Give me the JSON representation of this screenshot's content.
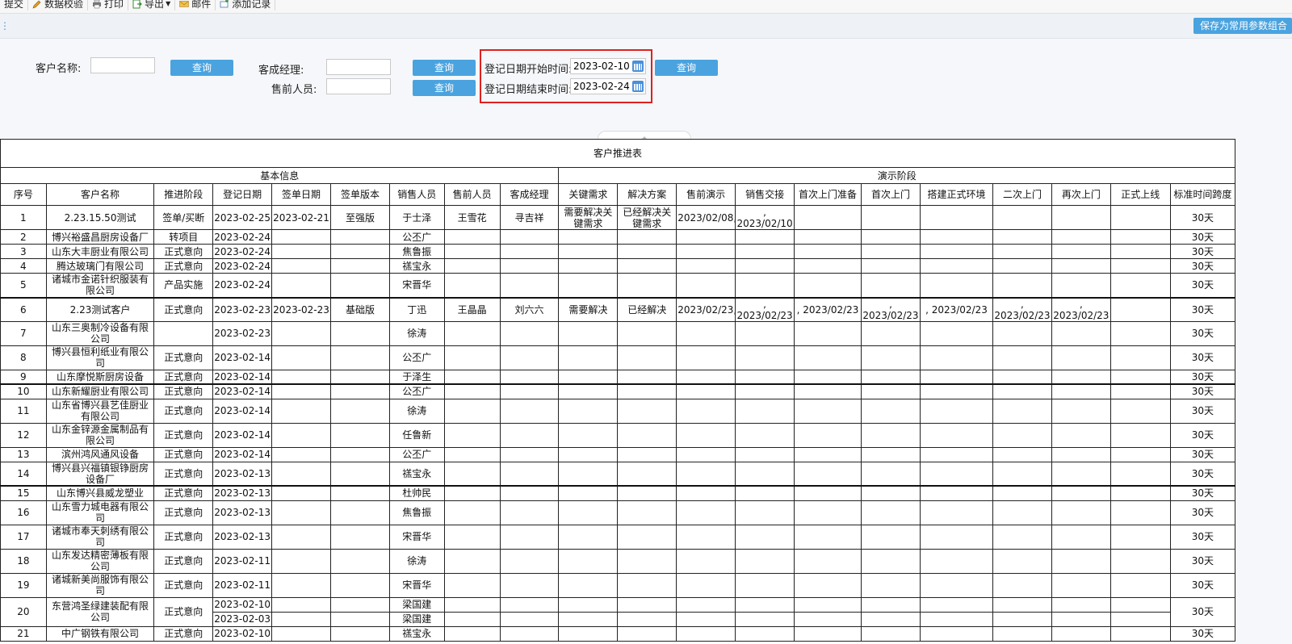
{
  "toolbar": {
    "items": [
      {
        "label": "提交",
        "icon": "submit-icon"
      },
      {
        "label": "数据校验",
        "icon": "pencil-icon"
      },
      {
        "label": "打印",
        "icon": "printer-icon"
      },
      {
        "label": "导出",
        "icon": "export-icon"
      },
      {
        "label": "邮件",
        "icon": "mail-icon"
      },
      {
        "label": "添加记录",
        "icon": "add-record-icon"
      }
    ],
    "save_params": "保存为常用参数组合"
  },
  "filters": {
    "customer_name_label": "客户名称:",
    "customer_name_value": "",
    "success_manager_label": "客成经理:",
    "success_manager_value": "",
    "presales_label": "售前人员:",
    "presales_value": "",
    "start_date_label": "登记日期开始时间:",
    "start_date_value": "2023-02-10",
    "end_date_label": "登记日期结束时间:",
    "end_date_value": "2023-02-24",
    "query_label": "查询"
  },
  "table": {
    "title": "客户推进表",
    "group_basic": "基本信息",
    "group_demo": "演示阶段",
    "headers": [
      "序号",
      "客户名称",
      "推进阶段",
      "登记日期",
      "签单日期",
      "签单版本",
      "销售人员",
      "售前人员",
      "客成经理",
      "关键需求",
      "解决方案",
      "售前演示",
      "销售交接",
      "首次上门准备",
      "首次上门",
      "搭建正式环境",
      "二次上门",
      "再次上门",
      "正式上线",
      "标准时间跨度"
    ],
    "rows": [
      {
        "no": "1",
        "name": "2.23.15.50测试",
        "stage": "签单/买断",
        "reg": "2023-02-25",
        "sign": "2023-02-21",
        "ver": "至强版",
        "sales": "于士泽",
        "pre": "王雪花",
        "mgr": "寻吉祥",
        "need": "需要解决关键需求",
        "sol": "已经解决关键需求",
        "demo": "2023/02/08,",
        "handover": ", 2023/02/10",
        "prep": "",
        "first": "",
        "env": "",
        "second": "",
        "again": "",
        "online": "",
        "span": "30天"
      },
      {
        "no": "2",
        "name": "博兴裕盛昌厨房设备厂",
        "stage": "转项目",
        "reg": "2023-02-24",
        "sign": "",
        "ver": "",
        "sales": "公丕广",
        "pre": "",
        "mgr": "",
        "need": "",
        "sol": "",
        "demo": "",
        "handover": "",
        "prep": "",
        "first": "",
        "env": "",
        "second": "",
        "again": "",
        "online": "",
        "span": "30天"
      },
      {
        "no": "3",
        "name": "山东大丰厨业有限公司",
        "stage": "正式意向",
        "reg": "2023-02-24",
        "sign": "",
        "ver": "",
        "sales": "焦鲁振",
        "pre": "",
        "mgr": "",
        "need": "",
        "sol": "",
        "demo": "",
        "handover": "",
        "prep": "",
        "first": "",
        "env": "",
        "second": "",
        "again": "",
        "online": "",
        "span": "30天"
      },
      {
        "no": "4",
        "name": "腾达玻璃门有限公司",
        "stage": "正式意向",
        "reg": "2023-02-24",
        "sign": "",
        "ver": "",
        "sales": "禚宝永",
        "pre": "",
        "mgr": "",
        "need": "",
        "sol": "",
        "demo": "",
        "handover": "",
        "prep": "",
        "first": "",
        "env": "",
        "second": "",
        "again": "",
        "online": "",
        "span": "30天"
      },
      {
        "no": "5",
        "name": "诸城市金诺针织服装有限公司",
        "stage": "产品实施",
        "reg": "2023-02-24",
        "sign": "",
        "ver": "",
        "sales": "宋晋华",
        "pre": "",
        "mgr": "",
        "need": "",
        "sol": "",
        "demo": "",
        "handover": "",
        "prep": "",
        "first": "",
        "env": "",
        "second": "",
        "again": "",
        "online": "",
        "span": "30天"
      },
      {
        "no": "6",
        "name": "2.23测试客户",
        "stage": "正式意向",
        "reg": "2023-02-23",
        "sign": "2023-02-23",
        "ver": "基础版",
        "sales": "丁迅",
        "pre": "王晶晶",
        "mgr": "刘六六",
        "need": "需要解决",
        "sol": "已经解决",
        "demo": "2023/02/23,",
        "handover": ", 2023/02/23",
        "prep": ", 2023/02/23",
        "first": ", 2023/02/23",
        "env": ", 2023/02/23",
        "second": ", 2023/02/23",
        "again": ", 2023/02/23",
        "online": "",
        "span": "30天"
      },
      {
        "no": "7",
        "name": "山东三奥制冷设备有限公司",
        "stage": "",
        "reg": "2023-02-23",
        "sign": "",
        "ver": "",
        "sales": "徐涛",
        "pre": "",
        "mgr": "",
        "need": "",
        "sol": "",
        "demo": "",
        "handover": "",
        "prep": "",
        "first": "",
        "env": "",
        "second": "",
        "again": "",
        "online": "",
        "span": "30天"
      },
      {
        "no": "8",
        "name": "博兴县恒利纸业有限公司",
        "stage": "正式意向",
        "reg": "2023-02-14",
        "sign": "",
        "ver": "",
        "sales": "公丕广",
        "pre": "",
        "mgr": "",
        "need": "",
        "sol": "",
        "demo": "",
        "handover": "",
        "prep": "",
        "first": "",
        "env": "",
        "second": "",
        "again": "",
        "online": "",
        "span": "30天"
      },
      {
        "no": "9",
        "name": "山东摩悦斯厨房设备",
        "stage": "正式意向",
        "reg": "2023-02-14",
        "sign": "",
        "ver": "",
        "sales": "于泽生",
        "pre": "",
        "mgr": "",
        "need": "",
        "sol": "",
        "demo": "",
        "handover": "",
        "prep": "",
        "first": "",
        "env": "",
        "second": "",
        "again": "",
        "online": "",
        "span": "30天"
      },
      {
        "no": "10",
        "name": "山东新耀厨业有限公司",
        "stage": "正式意向",
        "reg": "2023-02-14",
        "sign": "",
        "ver": "",
        "sales": "公丕广",
        "pre": "",
        "mgr": "",
        "need": "",
        "sol": "",
        "demo": "",
        "handover": "",
        "prep": "",
        "first": "",
        "env": "",
        "second": "",
        "again": "",
        "online": "",
        "span": "30天"
      },
      {
        "no": "11",
        "name": "山东省博兴县艺佳厨业有限公司",
        "stage": "正式意向",
        "reg": "2023-02-14",
        "sign": "",
        "ver": "",
        "sales": "徐涛",
        "pre": "",
        "mgr": "",
        "need": "",
        "sol": "",
        "demo": "",
        "handover": "",
        "prep": "",
        "first": "",
        "env": "",
        "second": "",
        "again": "",
        "online": "",
        "span": "30天"
      },
      {
        "no": "12",
        "name": "山东金锌源金属制品有限公司",
        "stage": "正式意向",
        "reg": "2023-02-14",
        "sign": "",
        "ver": "",
        "sales": "任鲁新",
        "pre": "",
        "mgr": "",
        "need": "",
        "sol": "",
        "demo": "",
        "handover": "",
        "prep": "",
        "first": "",
        "env": "",
        "second": "",
        "again": "",
        "online": "",
        "span": "30天"
      },
      {
        "no": "13",
        "name": "滨州鸿风通风设备",
        "stage": "正式意向",
        "reg": "2023-02-14",
        "sign": "",
        "ver": "",
        "sales": "公丕广",
        "pre": "",
        "mgr": "",
        "need": "",
        "sol": "",
        "demo": "",
        "handover": "",
        "prep": "",
        "first": "",
        "env": "",
        "second": "",
        "again": "",
        "online": "",
        "span": "30天"
      },
      {
        "no": "14",
        "name": "博兴县兴福镇银铮厨房设备厂",
        "stage": "正式意向",
        "reg": "2023-02-13",
        "sign": "",
        "ver": "",
        "sales": "禚宝永",
        "pre": "",
        "mgr": "",
        "need": "",
        "sol": "",
        "demo": "",
        "handover": "",
        "prep": "",
        "first": "",
        "env": "",
        "second": "",
        "again": "",
        "online": "",
        "span": "30天"
      },
      {
        "no": "15",
        "name": "山东博兴县威龙塑业",
        "stage": "正式意向",
        "reg": "2023-02-13",
        "sign": "",
        "ver": "",
        "sales": "杜帅民",
        "pre": "",
        "mgr": "",
        "need": "",
        "sol": "",
        "demo": "",
        "handover": "",
        "prep": "",
        "first": "",
        "env": "",
        "second": "",
        "again": "",
        "online": "",
        "span": "30天"
      },
      {
        "no": "16",
        "name": "山东雪力城电器有限公司",
        "stage": "正式意向",
        "reg": "2023-02-13",
        "sign": "",
        "ver": "",
        "sales": "焦鲁振",
        "pre": "",
        "mgr": "",
        "need": "",
        "sol": "",
        "demo": "",
        "handover": "",
        "prep": "",
        "first": "",
        "env": "",
        "second": "",
        "again": "",
        "online": "",
        "span": "30天"
      },
      {
        "no": "17",
        "name": "诸城市奉天刺绣有限公司",
        "stage": "正式意向",
        "reg": "2023-02-13",
        "sign": "",
        "ver": "",
        "sales": "宋晋华",
        "pre": "",
        "mgr": "",
        "need": "",
        "sol": "",
        "demo": "",
        "handover": "",
        "prep": "",
        "first": "",
        "env": "",
        "second": "",
        "again": "",
        "online": "",
        "span": "30天"
      },
      {
        "no": "18",
        "name": "山东发达精密薄板有限公司",
        "stage": "正式意向",
        "reg": "2023-02-11",
        "sign": "",
        "ver": "",
        "sales": "徐涛",
        "pre": "",
        "mgr": "",
        "need": "",
        "sol": "",
        "demo": "",
        "handover": "",
        "prep": "",
        "first": "",
        "env": "",
        "second": "",
        "again": "",
        "online": "",
        "span": "30天"
      },
      {
        "no": "19",
        "name": "诸城新美尚服饰有限公司",
        "stage": "正式意向",
        "reg": "2023-02-11",
        "sign": "",
        "ver": "",
        "sales": "宋晋华",
        "pre": "",
        "mgr": "",
        "need": "",
        "sol": "",
        "demo": "",
        "handover": "",
        "prep": "",
        "first": "",
        "env": "",
        "second": "",
        "again": "",
        "online": "",
        "span": "30天"
      }
    ],
    "row20": {
      "no": "20",
      "name": "东营鸿圣绿建装配有限公司",
      "stage": "正式意向",
      "reg1": "2023-02-10",
      "sales1": "梁国建",
      "reg2": "2023-02-03",
      "sales2": "梁国建",
      "span": "30天"
    },
    "row21": {
      "no": "21",
      "name": "中广钢铁有限公司",
      "stage": "正式意向",
      "reg": "2023-02-10",
      "sales": "禚宝永",
      "span": "30天"
    }
  }
}
